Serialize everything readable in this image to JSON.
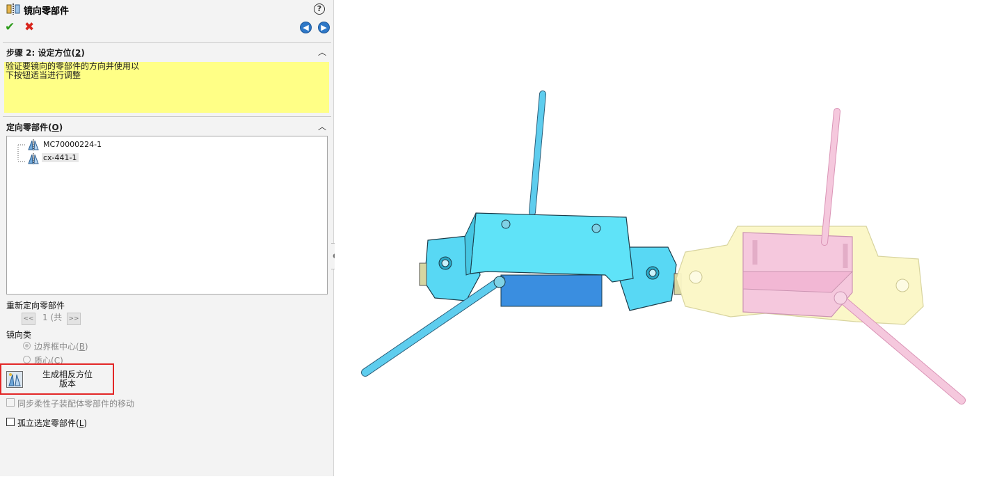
{
  "panel": {
    "title": "镜向零部件",
    "help_label": "?",
    "ok_icon": "✔",
    "cancel_icon": "✖",
    "back_icon": "◀",
    "forward_icon": "▶",
    "step_section": {
      "title_prefix": "步骤 2: 设定方位(",
      "shortcut": "2",
      "title_suffix": ")",
      "collapse_icon": "︿",
      "message_line1": "验证要镜向的零部件的方向并使用以",
      "message_line2": "下按钮适当进行调整"
    },
    "orient_section": {
      "title_prefix": "定向零部件(",
      "shortcut": "O",
      "title_suffix": ")",
      "collapse_icon": "︿",
      "components": [
        {
          "name": "MC70000224-1"
        },
        {
          "name": "cx-441-1"
        }
      ]
    },
    "reorient": {
      "label": "重新定向零部件",
      "prev_label": "<<",
      "page_text": "1 (共",
      "next_label": ">>"
    },
    "mirror_type": {
      "label": "镜向类",
      "option1_prefix": "边界框中心(",
      "option1_shortcut": "B",
      "option1_suffix": ")",
      "option2_prefix": "质心(",
      "option2_shortcut": "C",
      "option2_suffix": ")"
    },
    "generate_button": {
      "line1": "生成相反方位",
      "line2": "版本"
    },
    "sync_checkbox_label": "同步柔性子装配体零部件的移动",
    "isolate_checkbox": {
      "prefix": "孤立选定零部件(",
      "shortcut": "L",
      "suffix": ")"
    },
    "grip_icon": "●"
  },
  "colors": {
    "accent_blue": "#2e78c7",
    "highlight_red": "#e32626",
    "message_yellow": "#ffff86",
    "original_part": "#5fe0f5",
    "mirrored_part": "#f5c6dc",
    "mirrored_bracket": "#fbf7c6"
  }
}
